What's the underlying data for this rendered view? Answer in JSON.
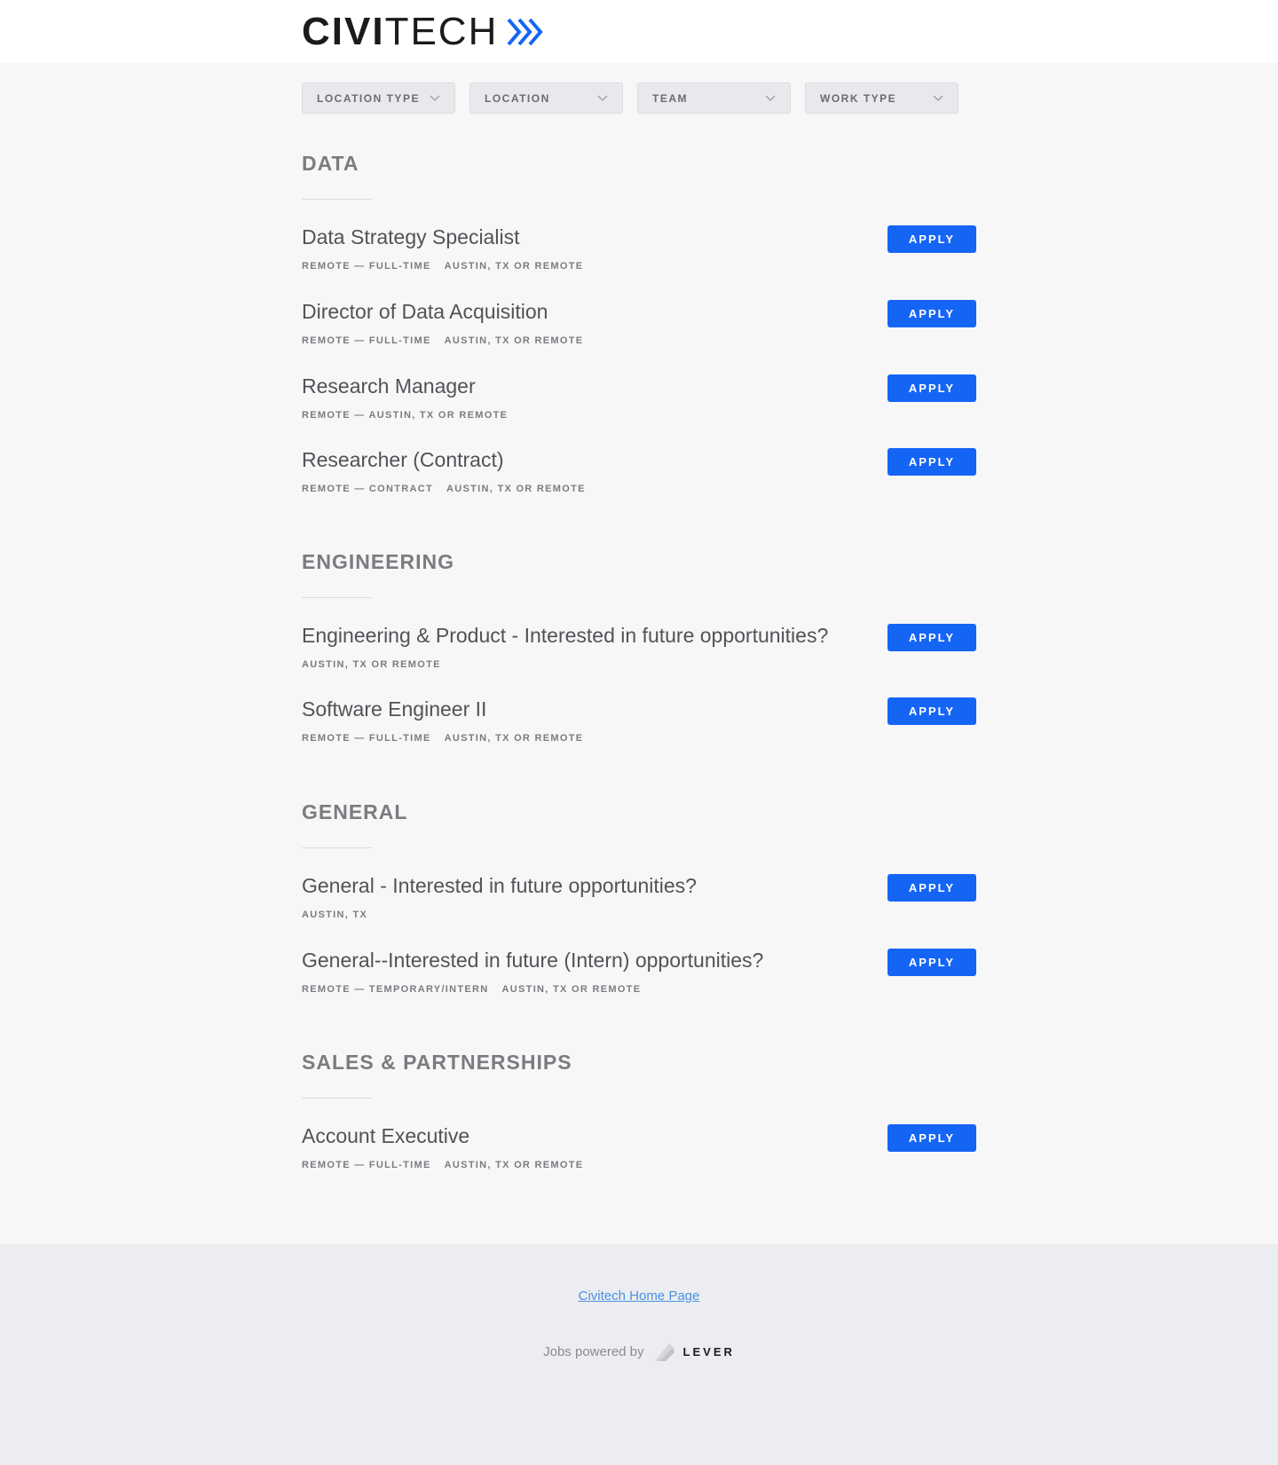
{
  "brand": {
    "logo_bold": "CIVI",
    "logo_light": "TECH",
    "accent_color": "#1565f5"
  },
  "filters": [
    {
      "label": "LOCATION TYPE",
      "icon": "chevron-down-icon"
    },
    {
      "label": "LOCATION",
      "icon": "chevron-down-icon"
    },
    {
      "label": "TEAM",
      "icon": "chevron-down-icon"
    },
    {
      "label": "WORK TYPE",
      "icon": "chevron-down-icon"
    }
  ],
  "apply_label": "APPLY",
  "groups": [
    {
      "title": "DATA",
      "postings": [
        {
          "title": "Data Strategy Specialist",
          "commitment": "REMOTE — FULL-TIME",
          "location": "AUSTIN, TX OR REMOTE"
        },
        {
          "title": "Director of Data Acquisition",
          "commitment": "REMOTE — FULL-TIME",
          "location": "AUSTIN, TX OR REMOTE"
        },
        {
          "title": "Research Manager",
          "commitment": "REMOTE — AUSTIN, TX OR REMOTE",
          "location": ""
        },
        {
          "title": "Researcher (Contract)",
          "commitment": "REMOTE — CONTRACT",
          "location": "AUSTIN, TX OR REMOTE"
        }
      ]
    },
    {
      "title": "ENGINEERING",
      "postings": [
        {
          "title": "Engineering & Product - Interested in future opportunities?",
          "commitment": "AUSTIN, TX OR REMOTE",
          "location": ""
        },
        {
          "title": "Software Engineer II",
          "commitment": "REMOTE — FULL-TIME",
          "location": "AUSTIN, TX OR REMOTE"
        }
      ]
    },
    {
      "title": "GENERAL",
      "postings": [
        {
          "title": "General - Interested in future opportunities?",
          "commitment": "AUSTIN, TX",
          "location": ""
        },
        {
          "title": "General--Interested in future (Intern) opportunities?",
          "commitment": "REMOTE — TEMPORARY/INTERN",
          "location": "AUSTIN, TX OR REMOTE"
        }
      ]
    },
    {
      "title": "SALES & PARTNERSHIPS",
      "postings": [
        {
          "title": "Account Executive",
          "commitment": "REMOTE — FULL-TIME",
          "location": "AUSTIN, TX OR REMOTE"
        }
      ]
    }
  ],
  "footer": {
    "home_link": "Civitech Home Page",
    "powered_by": "Jobs powered by",
    "lever_word": "LEVER"
  }
}
